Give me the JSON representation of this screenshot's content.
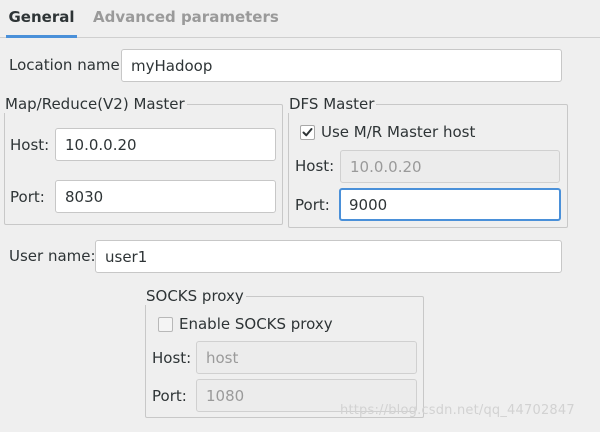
{
  "tabs": [
    {
      "label": "General",
      "active": true
    },
    {
      "label": "Advanced parameters",
      "active": false
    }
  ],
  "location": {
    "label": "Location name:",
    "value": "myHadoop"
  },
  "mapreduce_master": {
    "title": "Map/Reduce(V2) Master",
    "host_label": "Host:",
    "host_value": "10.0.0.20",
    "port_label": "Port:",
    "port_value": "8030"
  },
  "dfs_master": {
    "title": "DFS Master",
    "use_mr_host_label": "Use M/R Master host",
    "use_mr_host_checked": true,
    "host_label": "Host:",
    "host_value": "10.0.0.20",
    "port_label": "Port:",
    "port_value": "9000"
  },
  "user": {
    "label": "User name:",
    "value": "user1"
  },
  "socks_proxy": {
    "title": "SOCKS proxy",
    "enable_label": "Enable SOCKS proxy",
    "enable_checked": false,
    "host_label": "Host:",
    "host_value": "host",
    "port_label": "Port:",
    "port_value": "1080"
  },
  "watermark": "https://blog.csdn.net/qq_44702847",
  "colors": {
    "accent": "#4a90d9",
    "background": "#efefef"
  }
}
